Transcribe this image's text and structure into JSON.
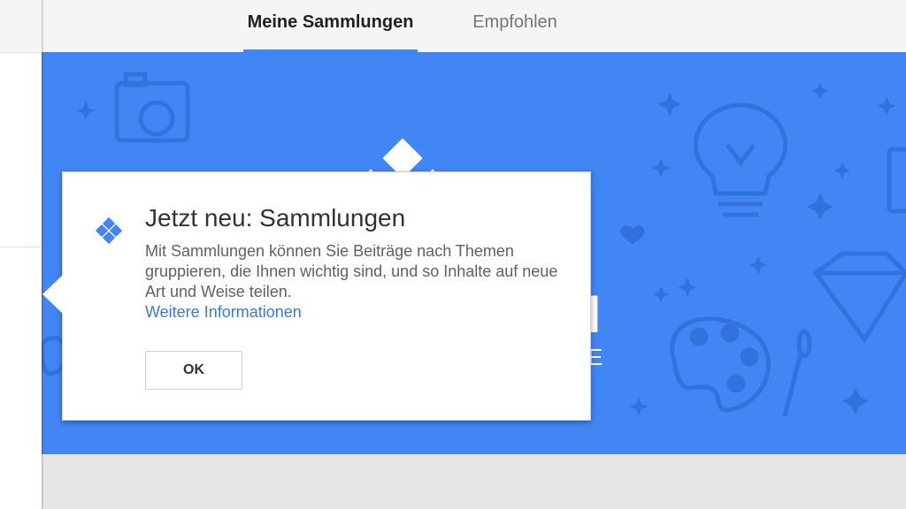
{
  "tabs": {
    "my_collections": "Meine Sammlungen",
    "recommended": "Empfohlen"
  },
  "banner": {
    "partial_heading": "N",
    "partial_subheading": "E"
  },
  "dialog": {
    "title": "Jetzt neu: Sammlungen",
    "body": "Mit Sammlungen können Sie Beiträge nach Themen gruppieren, die Ihnen wichtig sind, und so Inhalte auf neue Art und Weise teilen.",
    "link": "Weitere Informationen",
    "ok_label": "OK",
    "icon": "collections-diamond-icon"
  },
  "colors": {
    "accent": "#4285f4",
    "link": "#3b78e7"
  }
}
